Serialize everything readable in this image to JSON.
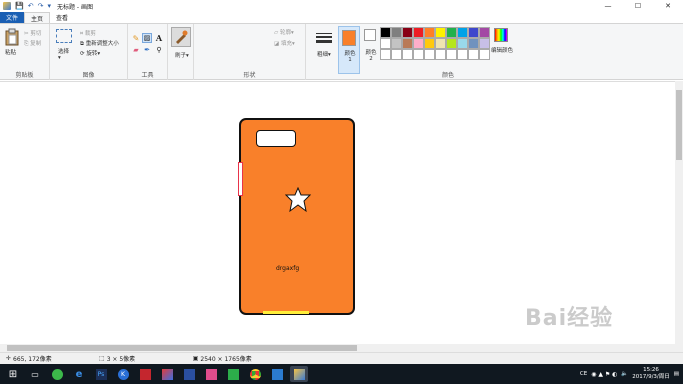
{
  "app": {
    "title": "无标题 - 画图"
  },
  "quick_access": {
    "save": "💾",
    "undo": "↶",
    "redo": "↷",
    "dropdown": "▾"
  },
  "window": {
    "min": "—",
    "max": "☐",
    "close": "✕"
  },
  "tabs": {
    "file": "文件",
    "home": "主页",
    "view": "查看"
  },
  "ribbon": {
    "clipboard": {
      "paste": "粘贴",
      "cut": "剪切",
      "copy": "复制",
      "label": "剪贴板"
    },
    "image": {
      "select": "选择",
      "crop": "裁剪",
      "resize": "重新调整大小",
      "rotate": "旋转",
      "label": "图像"
    },
    "tools": {
      "label": "工具"
    },
    "brushes": {
      "label": "刷子"
    },
    "shapes": {
      "glyphs": [
        "╲",
        "⌒",
        "▭",
        "▢",
        "⬭",
        "△",
        "◺",
        "⬠",
        "⬡",
        "▷",
        "◁",
        "△",
        "▽",
        "➪",
        "⇨",
        "⇦",
        "⇧",
        "⇩",
        "✦",
        "☆",
        "✡",
        "▭",
        "◯",
        "☁",
        "♡",
        "⚡",
        "◧",
        "◨"
      ],
      "outline": "轮廓",
      "fill": "填充",
      "label": "形状"
    },
    "size": {
      "label": "粗细"
    },
    "color1": {
      "label": "颜色 1",
      "value": "#f9802a"
    },
    "color2": {
      "label": "颜色 2",
      "value": "#ffffff"
    },
    "colors": {
      "label": "颜色",
      "edit": "编辑颜色",
      "palette": [
        "#000000",
        "#7f7f7f",
        "#880015",
        "#ed1c24",
        "#ff7f27",
        "#fff200",
        "#22b14c",
        "#00a2e8",
        "#3f48cc",
        "#a349a4",
        "#ffffff",
        "#c3c3c3",
        "#b97a57",
        "#ffaec9",
        "#ffc90e",
        "#efe4b0",
        "#b5e61d",
        "#99d9ea",
        "#7092be",
        "#c8bfe7",
        "#ffffff",
        "#ffffff",
        "#ffffff",
        "#ffffff",
        "#ffffff",
        "#ffffff",
        "#ffffff",
        "#ffffff",
        "#ffffff",
        "#ffffff"
      ]
    }
  },
  "drawing": {
    "text": "drgaxfg",
    "body_color": "#f9802a",
    "accent": "#ffee3a",
    "side": "#e8344a"
  },
  "status": {
    "position": "665, 172像素",
    "selection": "3 × 5像素",
    "size": "2540 × 1765像素"
  },
  "taskbar": {
    "time": "15:26",
    "date": "2017/9/3/周日",
    "ime": "CE"
  },
  "watermark": "Bai经验"
}
